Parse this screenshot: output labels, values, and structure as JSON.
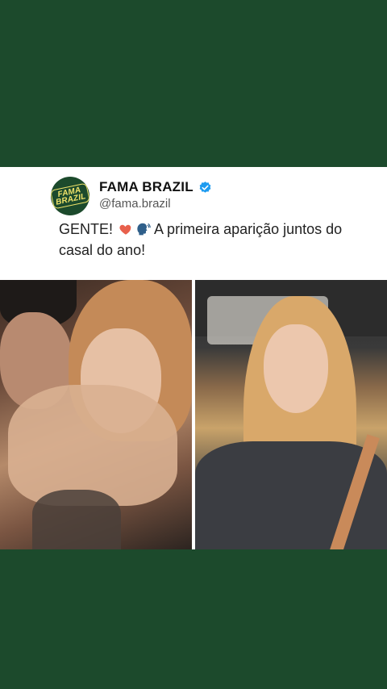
{
  "post": {
    "account_name": "FAMA BRAZIL",
    "handle": "@fama.brazil",
    "avatar_text_line1": "FAMA",
    "avatar_text_line2": "BRAZIL",
    "text_prefix": "GENTE!",
    "text_rest": " A primeira aparição juntos do casal do ano!",
    "emoji_1": "heart-icon",
    "emoji_2": "speaking-head-icon",
    "verified": true
  },
  "colors": {
    "background": "#1c4a2c",
    "card": "#ffffff",
    "verified_blue": "#1d9bf0",
    "heart": "#e8604c",
    "avatar_text": "#f0e36a"
  }
}
